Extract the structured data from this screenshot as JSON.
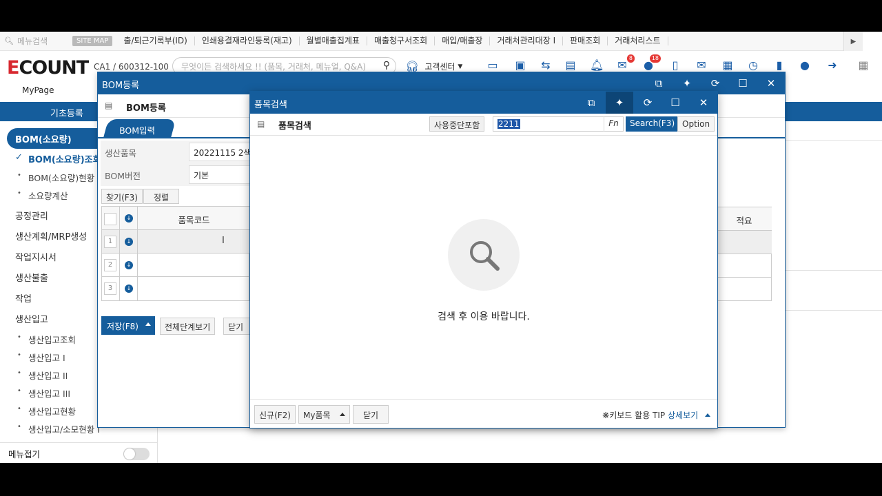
{
  "topbar": {
    "menu_search_placeholder": "메뉴검색",
    "sitemap_label": "SITE MAP",
    "quick_links": [
      "출/퇴근기록부(ID)",
      "인쇄용결재라인등록(재고)",
      "월별매출집계표",
      "매출청구서조회",
      "매입/매출장",
      "거래처관리대장 I",
      "판매조회",
      "거래처리스트"
    ]
  },
  "header": {
    "logo_e": "E",
    "logo_rest": "COUNT",
    "company": "CA1 / 600312-100",
    "search_placeholder": "무엇이든 검색하세요 !! (품목, 거래처, 메뉴얼, Q&A)",
    "support_label": "고객센터",
    "badge_mail": "8",
    "badge_chat": "18",
    "mypage": "MyPage"
  },
  "nav": {
    "basic_label": "기초등록"
  },
  "sidebar": {
    "active": "BOM(소요량)",
    "checked_item": "BOM(소요량)조회",
    "sub_items_1": [
      "BOM(소요량)현황",
      "소요량계산"
    ],
    "items": [
      "공정관리",
      "생산계획/MRP생성",
      "작업지시서",
      "생산불출",
      "작업",
      "생산입고"
    ],
    "sub_items_2": [
      "생산입고조회",
      "생산입고 I",
      "생산입고 II",
      "생산입고 III",
      "생산입고현황",
      "생산입고/소모현황 I"
    ],
    "fold_label": "메뉴접기"
  },
  "bom_window": {
    "title": "BOM등록",
    "subtitle": "BOM등록",
    "tab_label": "BOM입력",
    "production_item_label": "생산품목",
    "production_item_value": "20221115 2색",
    "bom_version_label": "BOM버전",
    "bom_version_value": "기본",
    "find_btn": "찾기(F3)",
    "sort_btn": "정렬",
    "col_item_code": "품목코드",
    "col_remark": "적요",
    "rows": [
      "1",
      "2",
      "3"
    ],
    "save_btn": "저장(F8)",
    "view_all_btn": "전체단계보기",
    "close_btn": "닫기"
  },
  "item_window": {
    "title": "품목검색",
    "subtitle": "품목검색",
    "include_stopped": "사용중단포함",
    "search_value": "2211",
    "fn_label": "Fn",
    "search_btn": "Search(F3)",
    "option_btn": "Option",
    "empty_message": "검색 후 이용 바랍니다.",
    "new_btn": "신규(F2)",
    "my_items_btn": "My품목",
    "close_btn": "닫기",
    "tip_label": "❋키보드 활용 TIP",
    "tip_link": "상세보기"
  },
  "colors": {
    "brand_blue": "#155d9c",
    "logo_red": "#d7282f"
  }
}
